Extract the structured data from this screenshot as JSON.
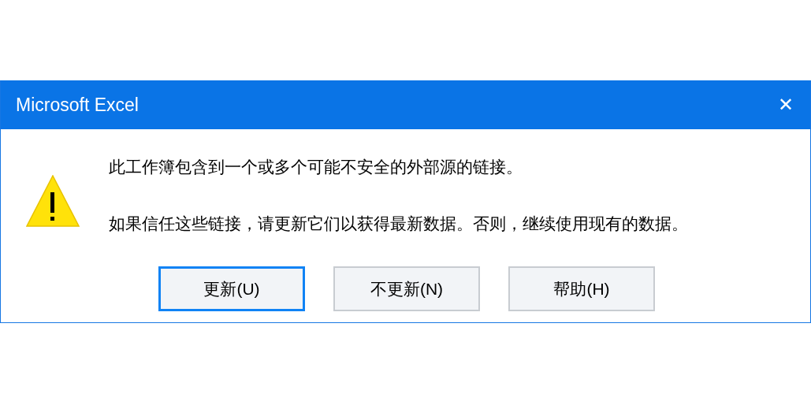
{
  "window": {
    "title": "Microsoft Excel",
    "close": "✕"
  },
  "message": [
    "此工作簿包含到一个或多个可能不安全的外部源的链接。",
    "如果信任这些链接，请更新它们以获得最新数据。否则，继续使用现有的数据。"
  ],
  "buttons": [
    {
      "label": "更新(U)",
      "default": true
    },
    {
      "label": "不更新(N)",
      "default": false
    },
    {
      "label": "帮助(H)",
      "default": false
    }
  ]
}
